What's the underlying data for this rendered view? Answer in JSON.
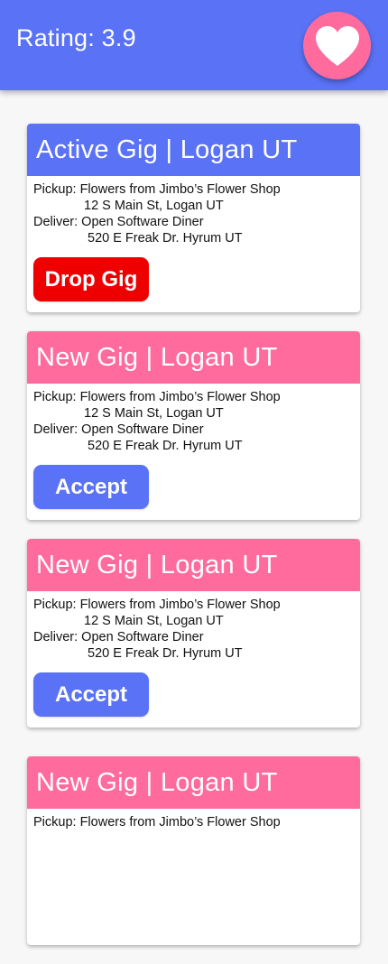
{
  "header": {
    "rating_label": "Rating: 3.9",
    "heart_icon": "heart-icon",
    "bar_color": "#5a72f5",
    "heart_button_color": "#ff6b9c"
  },
  "colors": {
    "active_header": "#5a72f5",
    "new_header": "#ff6b9c",
    "drop_button": "#ee0000",
    "accept_button": "#5a72f5"
  },
  "gigs": [
    {
      "status": "active",
      "title": "Active Gig | Logan UT",
      "pickup_line": "Pickup: Flowers from Jimbo’s Flower Shop",
      "pickup_address": "12 S Main St, Logan UT",
      "deliver_line": "Deliver: Open Software Diner",
      "deliver_address": "520 E Freak Dr. Hyrum UT",
      "action_label": "Drop Gig"
    },
    {
      "status": "new",
      "title": "New Gig | Logan UT",
      "pickup_line": "Pickup: Flowers from Jimbo’s Flower Shop",
      "pickup_address": "12 S Main St, Logan UT",
      "deliver_line": "Deliver: Open Software Diner",
      "deliver_address": "520 E Freak Dr. Hyrum UT",
      "action_label": "Accept"
    },
    {
      "status": "new",
      "title": "New Gig | Logan UT",
      "pickup_line": "Pickup: Flowers from Jimbo’s Flower Shop",
      "pickup_address": "12 S Main St, Logan UT",
      "deliver_line": "Deliver: Open Software Diner",
      "deliver_address": "520 E Freak Dr. Hyrum UT",
      "action_label": "Accept"
    },
    {
      "status": "new",
      "title": "New Gig | Logan UT",
      "pickup_line": "Pickup: Flowers from Jimbo’s Flower Shop",
      "pickup_address": "",
      "deliver_line": "",
      "deliver_address": "",
      "action_label": ""
    }
  ]
}
